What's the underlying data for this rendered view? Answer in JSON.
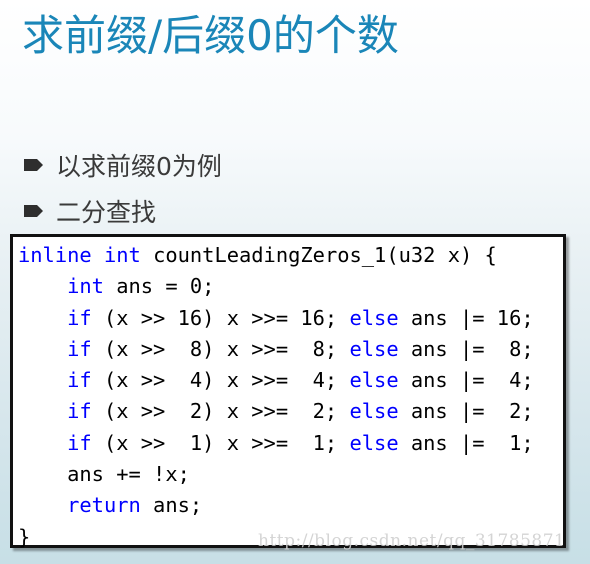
{
  "slide": {
    "title": "求前缀/后缀0的个数",
    "bullets": [
      {
        "icon": "arrow-bullet-icon",
        "text": "以求前缀0为例"
      },
      {
        "icon": "arrow-bullet-icon",
        "text": "二分查找"
      }
    ],
    "colors": {
      "title": "#1a86b8",
      "keyword": "#0000ff",
      "text": "#000000",
      "bullet_text": "#3a3a3a"
    }
  },
  "code": {
    "language": "c",
    "lines": [
      [
        {
          "t": "inline",
          "k": true
        },
        {
          "t": " "
        },
        {
          "t": "int",
          "k": true
        },
        {
          "t": " countLeadingZeros_1(u32 x) {"
        }
      ],
      [
        {
          "t": "    "
        },
        {
          "t": "int",
          "k": true
        },
        {
          "t": " ans = 0;"
        }
      ],
      [
        {
          "t": "    "
        },
        {
          "t": "if",
          "k": true
        },
        {
          "t": " (x >> 16) x >>= 16; "
        },
        {
          "t": "else",
          "k": true
        },
        {
          "t": " ans |= 16;"
        }
      ],
      [
        {
          "t": "    "
        },
        {
          "t": "if",
          "k": true
        },
        {
          "t": " (x >>  8) x >>=  8; "
        },
        {
          "t": "else",
          "k": true
        },
        {
          "t": " ans |=  8;"
        }
      ],
      [
        {
          "t": "    "
        },
        {
          "t": "if",
          "k": true
        },
        {
          "t": " (x >>  4) x >>=  4; "
        },
        {
          "t": "else",
          "k": true
        },
        {
          "t": " ans |=  4;"
        }
      ],
      [
        {
          "t": "    "
        },
        {
          "t": "if",
          "k": true
        },
        {
          "t": " (x >>  2) x >>=  2; "
        },
        {
          "t": "else",
          "k": true
        },
        {
          "t": " ans |=  2;"
        }
      ],
      [
        {
          "t": "    "
        },
        {
          "t": "if",
          "k": true
        },
        {
          "t": " (x >>  1) x >>=  1; "
        },
        {
          "t": "else",
          "k": true
        },
        {
          "t": " ans |=  1;"
        }
      ],
      [
        {
          "t": "    ans += !x;"
        }
      ],
      [
        {
          "t": "    "
        },
        {
          "t": "return",
          "k": true
        },
        {
          "t": " ans;"
        }
      ],
      [
        {
          "t": "}"
        }
      ]
    ]
  },
  "watermark": "http://blog.csdn.net/qq_31785871"
}
